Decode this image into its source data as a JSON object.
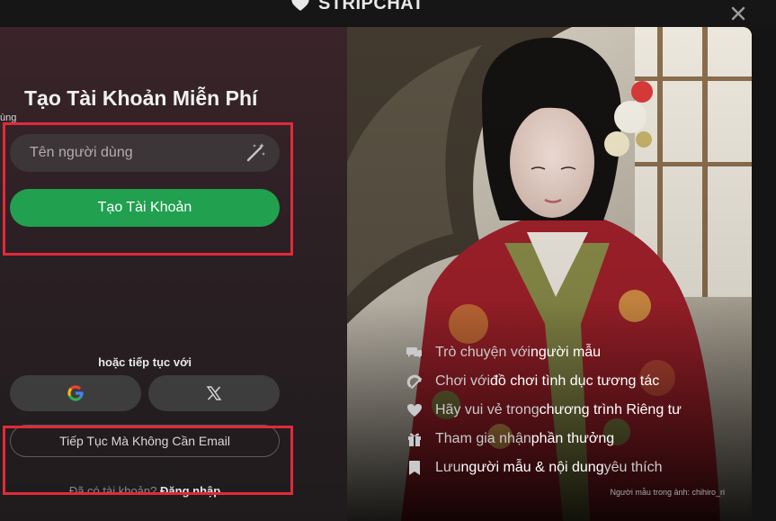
{
  "header": {
    "logo_text": "STRIPCHAT"
  },
  "signup": {
    "title": "Tạo Tài Khoản Miễn Phí",
    "stray_label": "ùng",
    "username_placeholder": "Tên người dùng",
    "create_button": "Tạo Tài Khoản",
    "or_continue": "hoặc tiếp tục với",
    "no_email_button": "Tiếp Tục Mà Không Cần Email",
    "have_account": "Đã có tài khoản?",
    "login_link": "Đăng nhập"
  },
  "features": [
    {
      "icon": "chat-bubbles-icon",
      "text_a": "Trò chuyện với ",
      "text_b": "người mẫu",
      "text_c": ""
    },
    {
      "icon": "toy-icon",
      "text_a": "Chơi với ",
      "text_b": "đồ chơi tình dục tương tác",
      "text_c": ""
    },
    {
      "icon": "heart-icon",
      "text_a": "Hãy vui vẻ trong ",
      "text_b": "chương trình Riêng tư",
      "text_c": ""
    },
    {
      "icon": "gift-icon",
      "text_a": "Tham gia nhận ",
      "text_b": "phần thưởng",
      "text_c": ""
    },
    {
      "icon": "bookmark-icon",
      "text_a": "Lưu ",
      "text_b": "người mẫu & nội dung",
      "text_c": " yêu thích"
    }
  ],
  "photo_credit": "Người mẫu trong ảnh: chihiro_ri",
  "colors": {
    "accent_green": "#21a04f",
    "highlight_red": "#e12a3a"
  }
}
